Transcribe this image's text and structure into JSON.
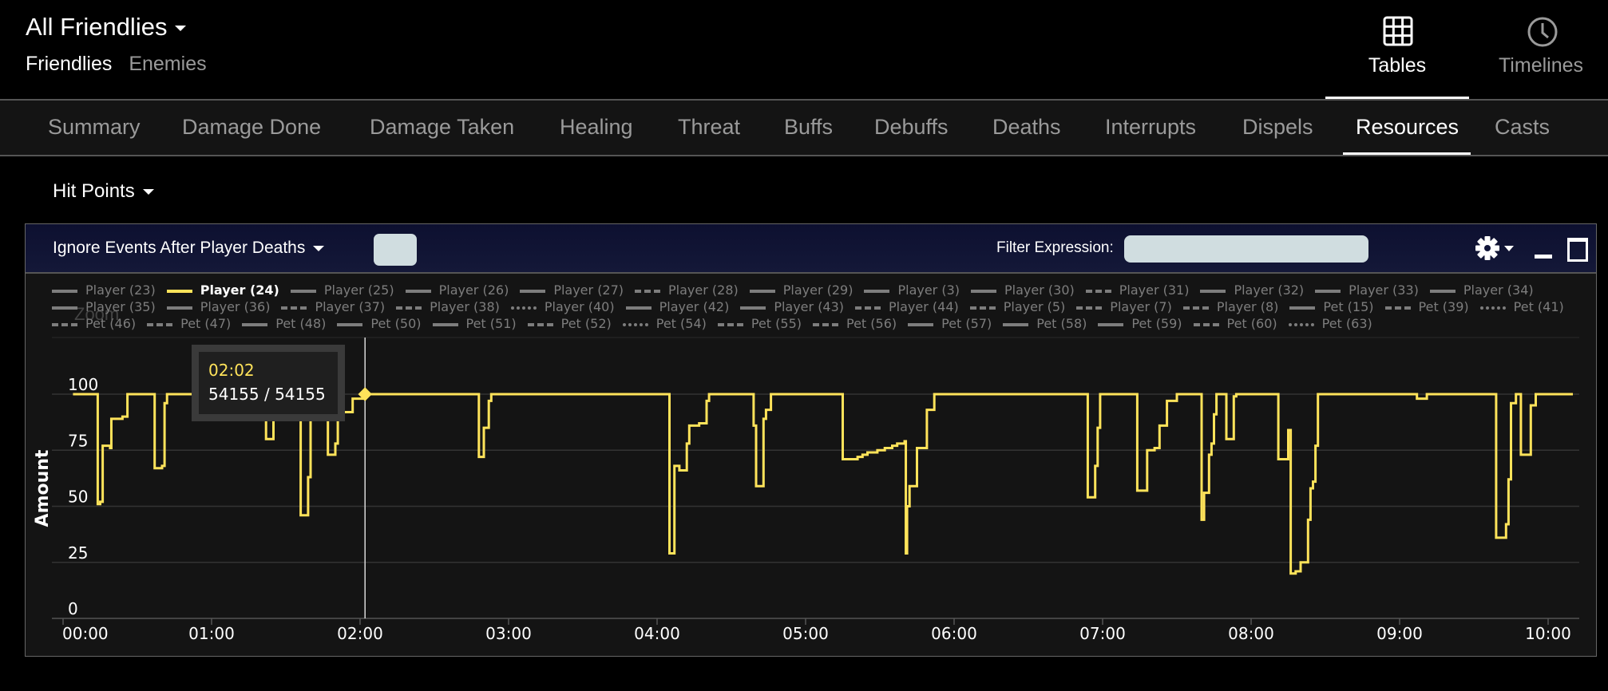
{
  "header": {
    "title": "All Friendlies",
    "subnav": [
      {
        "label": "Friendlies",
        "active": true
      },
      {
        "label": "Enemies",
        "active": false
      }
    ],
    "views": [
      {
        "label": "Tables",
        "icon": "grid-icon",
        "active": true
      },
      {
        "label": "Timelines",
        "icon": "clock-icon",
        "active": false
      }
    ]
  },
  "tabs": [
    {
      "label": "Summary",
      "active": false
    },
    {
      "label": "Damage Done",
      "active": false
    },
    {
      "label": "Damage Taken",
      "active": false
    },
    {
      "label": "Healing",
      "active": false
    },
    {
      "label": "Threat",
      "active": false
    },
    {
      "label": "Buffs",
      "active": false
    },
    {
      "label": "Debuffs",
      "active": false
    },
    {
      "label": "Deaths",
      "active": false
    },
    {
      "label": "Interrupts",
      "active": false
    },
    {
      "label": "Dispels",
      "active": false
    },
    {
      "label": "Resources",
      "active": true
    },
    {
      "label": "Casts",
      "active": false
    }
  ],
  "metric_selector": "Hit Points",
  "panel": {
    "ignore_label": "Ignore Events After Player Deaths",
    "filter_label": "Filter Expression:",
    "filter_value": "",
    "zoom_label": "Zoom"
  },
  "tooltip": {
    "time": "02:02",
    "value": "54155 / 54155"
  },
  "legend": [
    {
      "label": "Player (23)",
      "style": "solid"
    },
    {
      "label": "Player (24)",
      "style": "solid",
      "active": true
    },
    {
      "label": "Player (25)",
      "style": "solid"
    },
    {
      "label": "Player (26)",
      "style": "solid"
    },
    {
      "label": "Player (27)",
      "style": "solid"
    },
    {
      "label": "Player (28)",
      "style": "dash"
    },
    {
      "label": "Player (29)",
      "style": "solid"
    },
    {
      "label": "Player (3)",
      "style": "solid"
    },
    {
      "label": "Player (30)",
      "style": "solid"
    },
    {
      "label": "Player (31)",
      "style": "dash"
    },
    {
      "label": "Player (32)",
      "style": "solid"
    },
    {
      "label": "Player (33)",
      "style": "solid"
    },
    {
      "label": "Player (34)",
      "style": "solid"
    },
    {
      "label": "Player (35)",
      "style": "solid"
    },
    {
      "label": "Player (36)",
      "style": "solid"
    },
    {
      "label": "Player (37)",
      "style": "dash"
    },
    {
      "label": "Player (38)",
      "style": "dash"
    },
    {
      "label": "Player (40)",
      "style": "dot"
    },
    {
      "label": "Player (42)",
      "style": "solid"
    },
    {
      "label": "Player (43)",
      "style": "solid"
    },
    {
      "label": "Player (44)",
      "style": "dash"
    },
    {
      "label": "Player (5)",
      "style": "dash"
    },
    {
      "label": "Player (7)",
      "style": "dash"
    },
    {
      "label": "Player (8)",
      "style": "dashdot"
    },
    {
      "label": "Pet (15)",
      "style": "solid"
    },
    {
      "label": "Pet (39)",
      "style": "dash"
    },
    {
      "label": "Pet (41)",
      "style": "dot"
    },
    {
      "label": "Pet (46)",
      "style": "dashdot"
    },
    {
      "label": "Pet (47)",
      "style": "dashdot"
    },
    {
      "label": "Pet (48)",
      "style": "solid"
    },
    {
      "label": "Pet (50)",
      "style": "solid"
    },
    {
      "label": "Pet (51)",
      "style": "solid"
    },
    {
      "label": "Pet (52)",
      "style": "dash"
    },
    {
      "label": "Pet (54)",
      "style": "dot"
    },
    {
      "label": "Pet (55)",
      "style": "dashdot"
    },
    {
      "label": "Pet (56)",
      "style": "dashdot"
    },
    {
      "label": "Pet (57)",
      "style": "solid"
    },
    {
      "label": "Pet (58)",
      "style": "solid"
    },
    {
      "label": "Pet (59)",
      "style": "solid"
    },
    {
      "label": "Pet (60)",
      "style": "dash"
    },
    {
      "label": "Pet (63)",
      "style": "dot"
    }
  ],
  "colors": {
    "series_active": "#ffe35a",
    "series_inactive": "#7d7d7d",
    "panel_header": "#12163a"
  },
  "chart_data": {
    "type": "line",
    "step": true,
    "title": "",
    "xlabel": "",
    "ylabel": "Amount",
    "xlim_seconds": [
      0,
      615
    ],
    "ylim": [
      0,
      100
    ],
    "yticks": [
      0,
      25,
      50,
      75,
      100
    ],
    "xticks": [
      "00:00",
      "01:00",
      "02:00",
      "03:00",
      "04:00",
      "05:00",
      "06:00",
      "07:00",
      "08:00",
      "09:00",
      "10:00"
    ],
    "grid": true,
    "legend_position": "top",
    "cursor_time_seconds": 122,
    "cursor_value": 100,
    "series": [
      {
        "name": "Player (24)",
        "points_seconds_value": [
          [
            4,
            100
          ],
          [
            14,
            51
          ],
          [
            15,
            52
          ],
          [
            16,
            77
          ],
          [
            19,
            76
          ],
          [
            19.5,
            89
          ],
          [
            24,
            90
          ],
          [
            26,
            100
          ],
          [
            37,
            67
          ],
          [
            40,
            68
          ],
          [
            41,
            96
          ],
          [
            42,
            100
          ],
          [
            82,
            80
          ],
          [
            85,
            100
          ],
          [
            96,
            46
          ],
          [
            99,
            63
          ],
          [
            100,
            100
          ],
          [
            107,
            73
          ],
          [
            110,
            78
          ],
          [
            111,
            100
          ],
          [
            113,
            92
          ],
          [
            117,
            98
          ],
          [
            122,
            100
          ],
          [
            168,
            72
          ],
          [
            170,
            85
          ],
          [
            172,
            97
          ],
          [
            173,
            100
          ],
          [
            245,
            29
          ],
          [
            247,
            68
          ],
          [
            249,
            66
          ],
          [
            252,
            78
          ],
          [
            253,
            86
          ],
          [
            257,
            87
          ],
          [
            260,
            97
          ],
          [
            261,
            100
          ],
          [
            279,
            86
          ],
          [
            280,
            59
          ],
          [
            283,
            89
          ],
          [
            284,
            93
          ],
          [
            286,
            100
          ],
          [
            315,
            71
          ],
          [
            321,
            72
          ],
          [
            323,
            73
          ],
          [
            325,
            74
          ],
          [
            329,
            75
          ],
          [
            332,
            76
          ],
          [
            335,
            77
          ],
          [
            337,
            78
          ],
          [
            340,
            79
          ],
          [
            340.5,
            29
          ],
          [
            341,
            50
          ],
          [
            342,
            59
          ],
          [
            345,
            76
          ],
          [
            349,
            93
          ],
          [
            352,
            100
          ],
          [
            414,
            54
          ],
          [
            417,
            68
          ],
          [
            418,
            85
          ],
          [
            419,
            100
          ],
          [
            434,
            57
          ],
          [
            438,
            75
          ],
          [
            441,
            76
          ],
          [
            443,
            86
          ],
          [
            446,
            97
          ],
          [
            450,
            100
          ],
          [
            460,
            44
          ],
          [
            461,
            56
          ],
          [
            463,
            73
          ],
          [
            464,
            78
          ],
          [
            465,
            91
          ],
          [
            466,
            100
          ],
          [
            470,
            80
          ],
          [
            473,
            99
          ],
          [
            474,
            100
          ],
          [
            491,
            71
          ],
          [
            495,
            84
          ],
          [
            496,
            20
          ],
          [
            498,
            21
          ],
          [
            500,
            25
          ],
          [
            503,
            44
          ],
          [
            504,
            58
          ],
          [
            505,
            61
          ],
          [
            506,
            77
          ],
          [
            507,
            100
          ],
          [
            547,
            98
          ],
          [
            551,
            100
          ],
          [
            579,
            36
          ],
          [
            583,
            42
          ],
          [
            584,
            62
          ],
          [
            585,
            96
          ],
          [
            587,
            100
          ],
          [
            589,
            73
          ],
          [
            593,
            95
          ],
          [
            595,
            100
          ],
          [
            610,
            100
          ]
        ]
      }
    ]
  }
}
